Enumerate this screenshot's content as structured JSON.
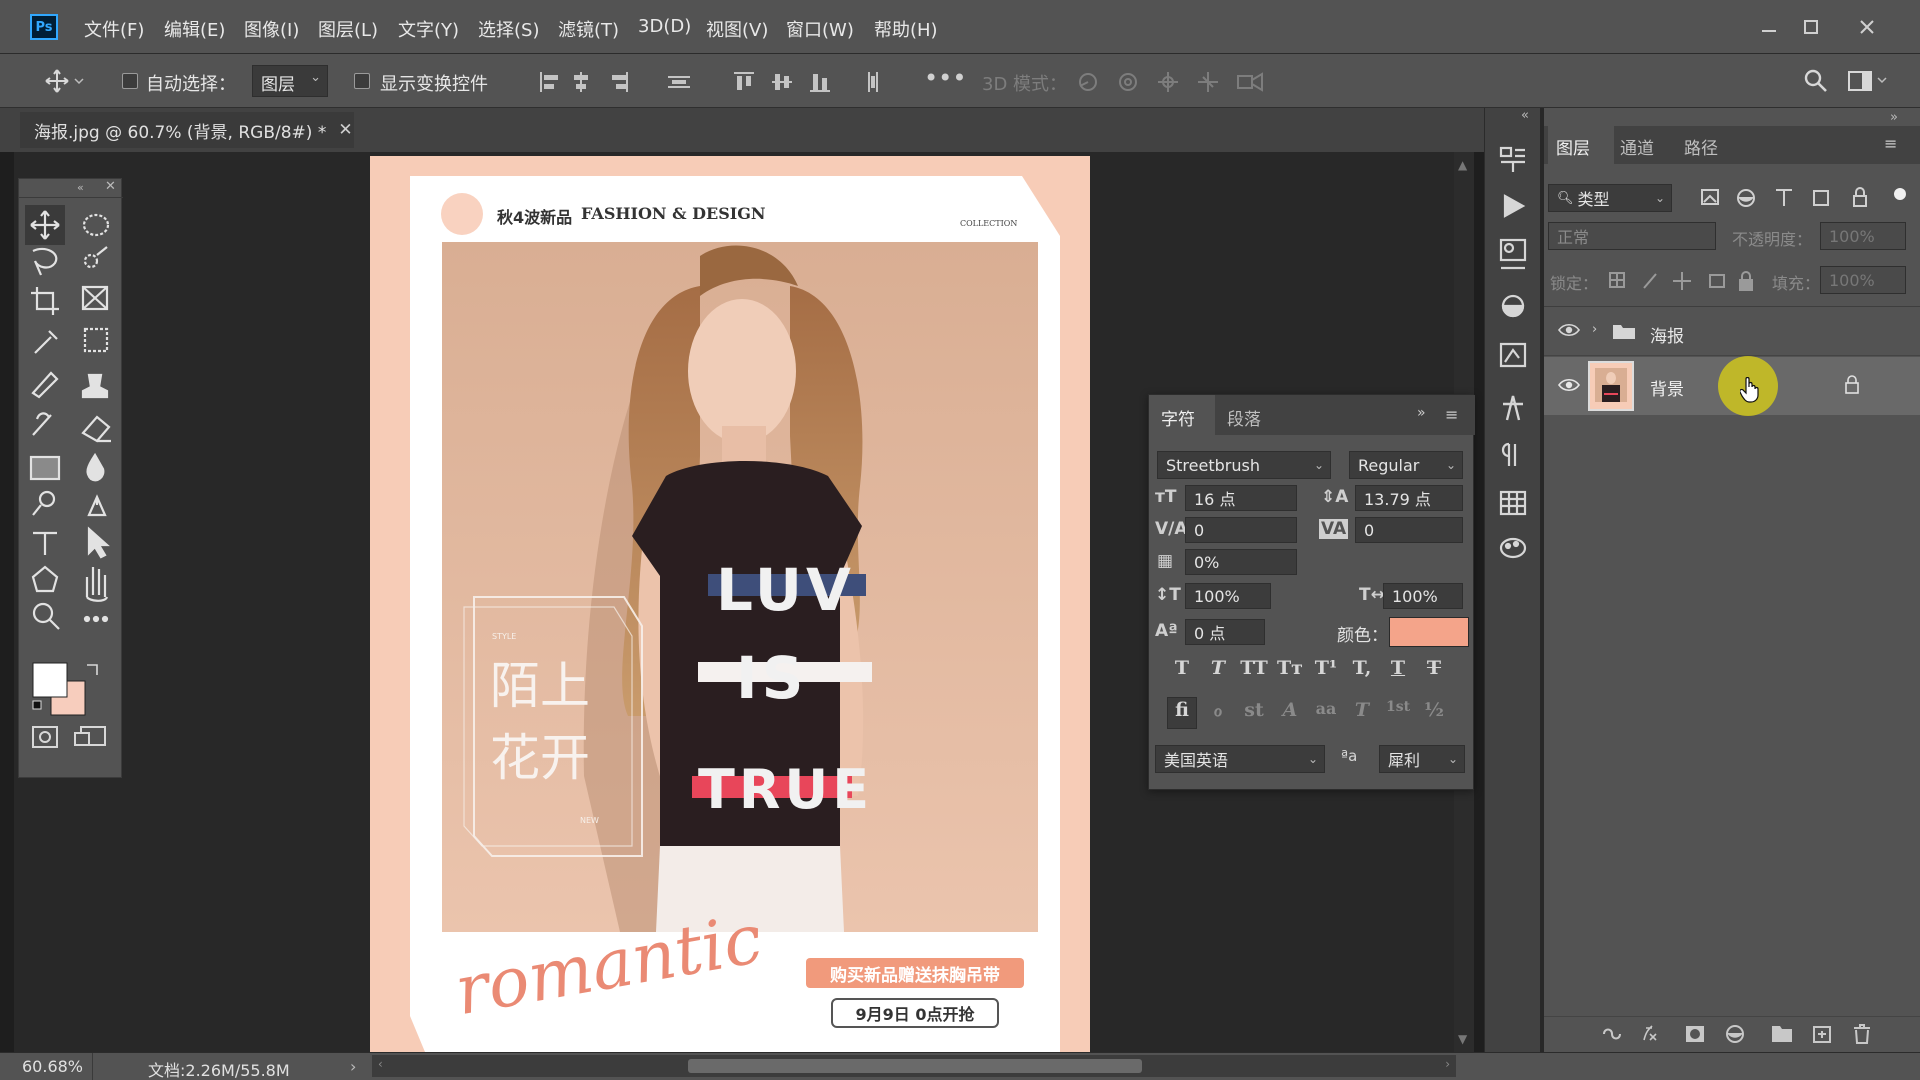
{
  "app": {
    "logo": "Ps",
    "menu": [
      "文件(F)",
      "编辑(E)",
      "图像(I)",
      "图层(L)",
      "文字(Y)",
      "选择(S)",
      "滤镜(T)",
      "3D(D)",
      "视图(V)",
      "窗口(W)",
      "帮助(H)"
    ]
  },
  "options_bar": {
    "auto_select_label": "自动选择：",
    "auto_select_target": "图层",
    "show_transform_label": "显示变换控件",
    "mode_3d_label": "3D 模式："
  },
  "document": {
    "tab_title": "海报.jpg @ 60.7% (背景, RGB/8#) *"
  },
  "poster": {
    "header_cn": "秋4波新品",
    "header_en": "FASHION & DESIGN",
    "collection": "COLLECTION",
    "style_small": "STYLE",
    "verse": [
      "陌上",
      "花开"
    ],
    "new_small": "NEW",
    "shirt_lines": [
      "LUV",
      "IS",
      "TRUE"
    ],
    "script": "romantic",
    "promo": "购买新品赠送抹胸吊带",
    "date": "9月9日 0点开抢"
  },
  "layers_panel": {
    "tabs": [
      "图层",
      "通道",
      "路径"
    ],
    "filter_kind": "类型",
    "blend_mode": "正常",
    "opacity_label": "不透明度：",
    "opacity_value": "100%",
    "lock_label": "锁定：",
    "fill_label": "填充：",
    "fill_value": "100%",
    "layers": [
      {
        "name": "海报",
        "type": "group"
      },
      {
        "name": "背景",
        "type": "image",
        "locked": true
      }
    ]
  },
  "character_panel": {
    "tabs": [
      "字符",
      "段落"
    ],
    "font_family": "Streetbrush",
    "font_style": "Regular",
    "size": "16 点",
    "leading": "13.79 点",
    "kerning": "0",
    "tracking": "0",
    "tsume": "0%",
    "vscale": "100%",
    "hscale": "100%",
    "baseline": "0 点",
    "color_label": "颜色：",
    "color_value": "#f4a48a",
    "style_buttons": [
      "T",
      "T",
      "TT",
      "Tт",
      "T¹",
      "T,",
      "T",
      "T"
    ],
    "opentype_buttons": [
      "fi",
      "ℴ",
      "st",
      "A",
      "aa",
      "T",
      "1st",
      "½"
    ],
    "language": "美国英语",
    "aa_icon": "ªa",
    "antialias": "犀利"
  },
  "status": {
    "zoom": "60.68%",
    "doc_size": "文档:2.26M/55.8M"
  },
  "colors": {
    "accent": "#31a8ff",
    "poster_bg": "#f7ccb7",
    "promo_pill": "#f19a7c",
    "fg_swatch": "#ffffff",
    "bg_swatch": "#f7cdbd"
  }
}
